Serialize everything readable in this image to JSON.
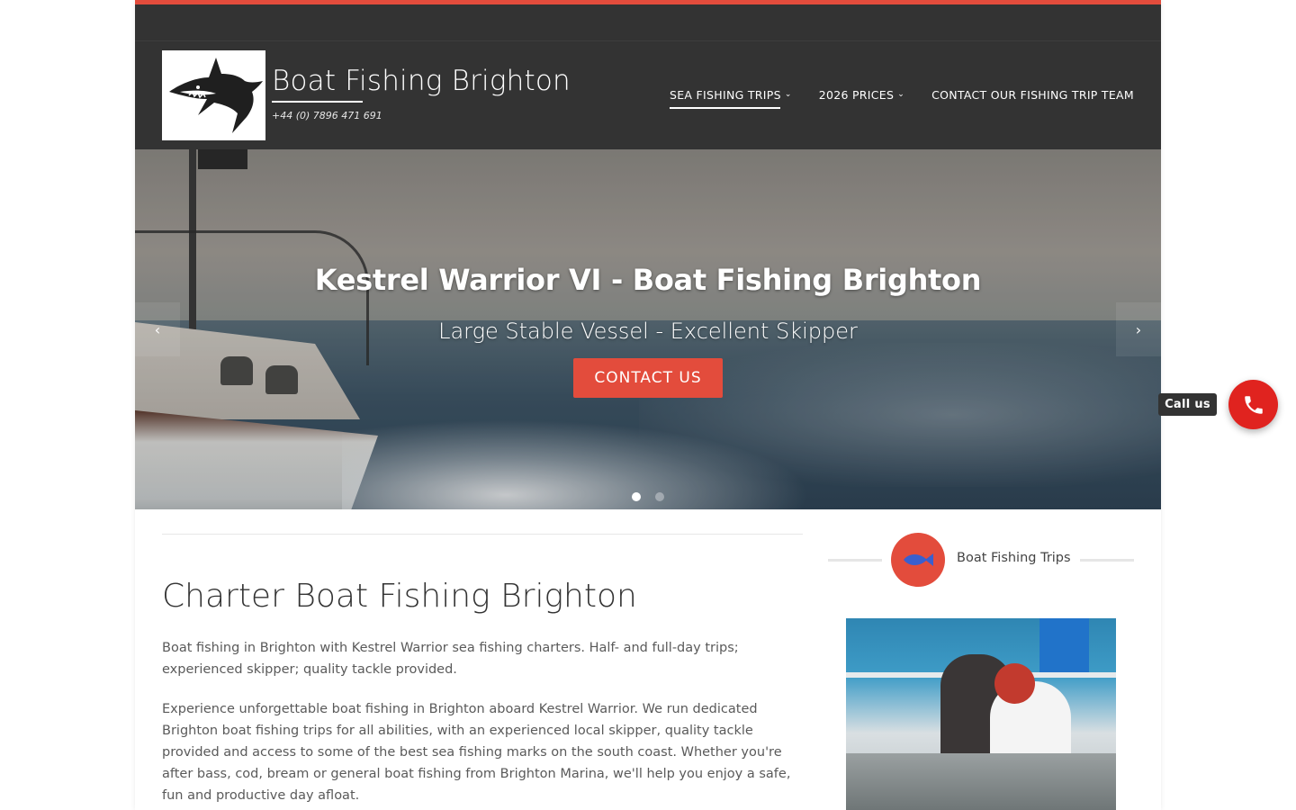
{
  "site": {
    "title": "Boat Fishing Brighton",
    "phone": "+44 (0) 7896 471 691",
    "logo_icon": "shark-logo-icon"
  },
  "nav": {
    "items": [
      {
        "label": "SEA FISHING TRIPS",
        "has_dropdown": true,
        "active": true
      },
      {
        "label": "2026 PRICES",
        "has_dropdown": true,
        "active": false
      },
      {
        "label": "CONTACT OUR FISHING TRIP TEAM",
        "has_dropdown": false,
        "active": false
      }
    ]
  },
  "hero": {
    "title": "Kestrel Warrior VI - Boat Fishing Brighton",
    "subtitle": "Large Stable Vessel - Excellent Skipper",
    "button_label": "CONTACT US",
    "prev_icon": "chevron-left-icon",
    "next_icon": "chevron-right-icon",
    "slides_total": 2,
    "active_slide": 1
  },
  "main": {
    "heading": "Charter Boat Fishing Brighton",
    "intro": "Boat fishing in Brighton with Kestrel Warrior sea fishing charters. Half- and full-day trips; experienced skipper; quality tackle provided.",
    "body": "Experience unforgettable boat fishing in Brighton aboard Kestrel Warrior. We run dedicated Brighton boat fishing trips for all abilities, with an experienced local skipper, quality tackle provided and access to some of the best sea fishing marks on the south coast. Whether you're after bass, cod, bream or general boat fishing from Brighton Marina, we'll help you enjoy a safe, fun and productive day afloat."
  },
  "sidebar": {
    "widget_title": "Boat Fishing Trips",
    "widget_icon": "fish-icon"
  },
  "call_widget": {
    "label": "Call us",
    "icon": "phone-icon"
  },
  "colors": {
    "accent": "#e34c3c",
    "header_bg": "#333333",
    "call_button": "#e0231f"
  }
}
